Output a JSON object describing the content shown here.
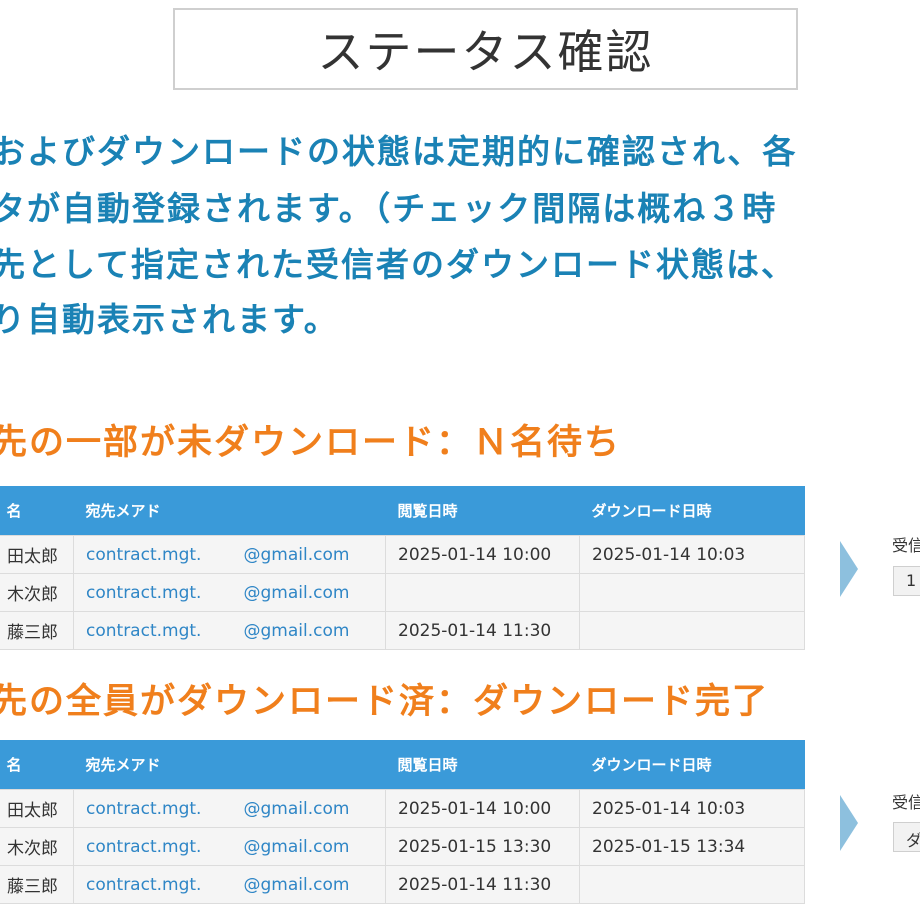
{
  "title": "ステータス確認",
  "description": [
    "およびダウンロードの状態は定期的に確認され、各",
    "タが自動登録されます。（チェック間隔は概ね３時",
    "先として指定された受信者のダウンロード状態は、",
    "り自動表示されます。"
  ],
  "sections": [
    {
      "heading": "先の一部が未ダウンロード：Ｎ名待ち",
      "columns": [
        "名",
        "宛先メアド",
        "閲覧日時",
        "ダウンロード日時"
      ],
      "rows": [
        {
          "name": "田太郎",
          "mail": "contract.mgt.",
          "domain": "@gmail.com",
          "viewed": "2025-01-14 10:00",
          "downloaded": "2025-01-14 10:03"
        },
        {
          "name": "木次郎",
          "mail": "contract.mgt.",
          "domain": "@gmail.com",
          "viewed": "",
          "downloaded": ""
        },
        {
          "name": "藤三郎",
          "mail": "contract.mgt.",
          "domain": "@gmail.com",
          "viewed": "2025-01-14 11:30",
          "downloaded": ""
        }
      ],
      "side_label": "受信",
      "side_value": "1"
    },
    {
      "heading": "先の全員がダウンロード済：ダウンロード完了",
      "columns": [
        "名",
        "宛先メアド",
        "閲覧日時",
        "ダウンロード日時"
      ],
      "rows": [
        {
          "name": "田太郎",
          "mail": "contract.mgt.",
          "domain": "@gmail.com",
          "viewed": "2025-01-14 10:00",
          "downloaded": "2025-01-14 10:03"
        },
        {
          "name": "木次郎",
          "mail": "contract.mgt.",
          "domain": "@gmail.com",
          "viewed": "2025-01-15 13:30",
          "downloaded": "2025-01-15 13:34"
        },
        {
          "name": "藤三郎",
          "mail": "contract.mgt.",
          "domain": "@gmail.com",
          "viewed": "2025-01-14 11:30",
          "downloaded": ""
        }
      ],
      "side_label": "受信",
      "side_value": "ダ"
    }
  ],
  "colors": {
    "accent_blue": "#1a82b5",
    "heading_orange": "#f07f1c",
    "table_header": "#3a9ad9",
    "link_blue": "#2f86c6"
  }
}
